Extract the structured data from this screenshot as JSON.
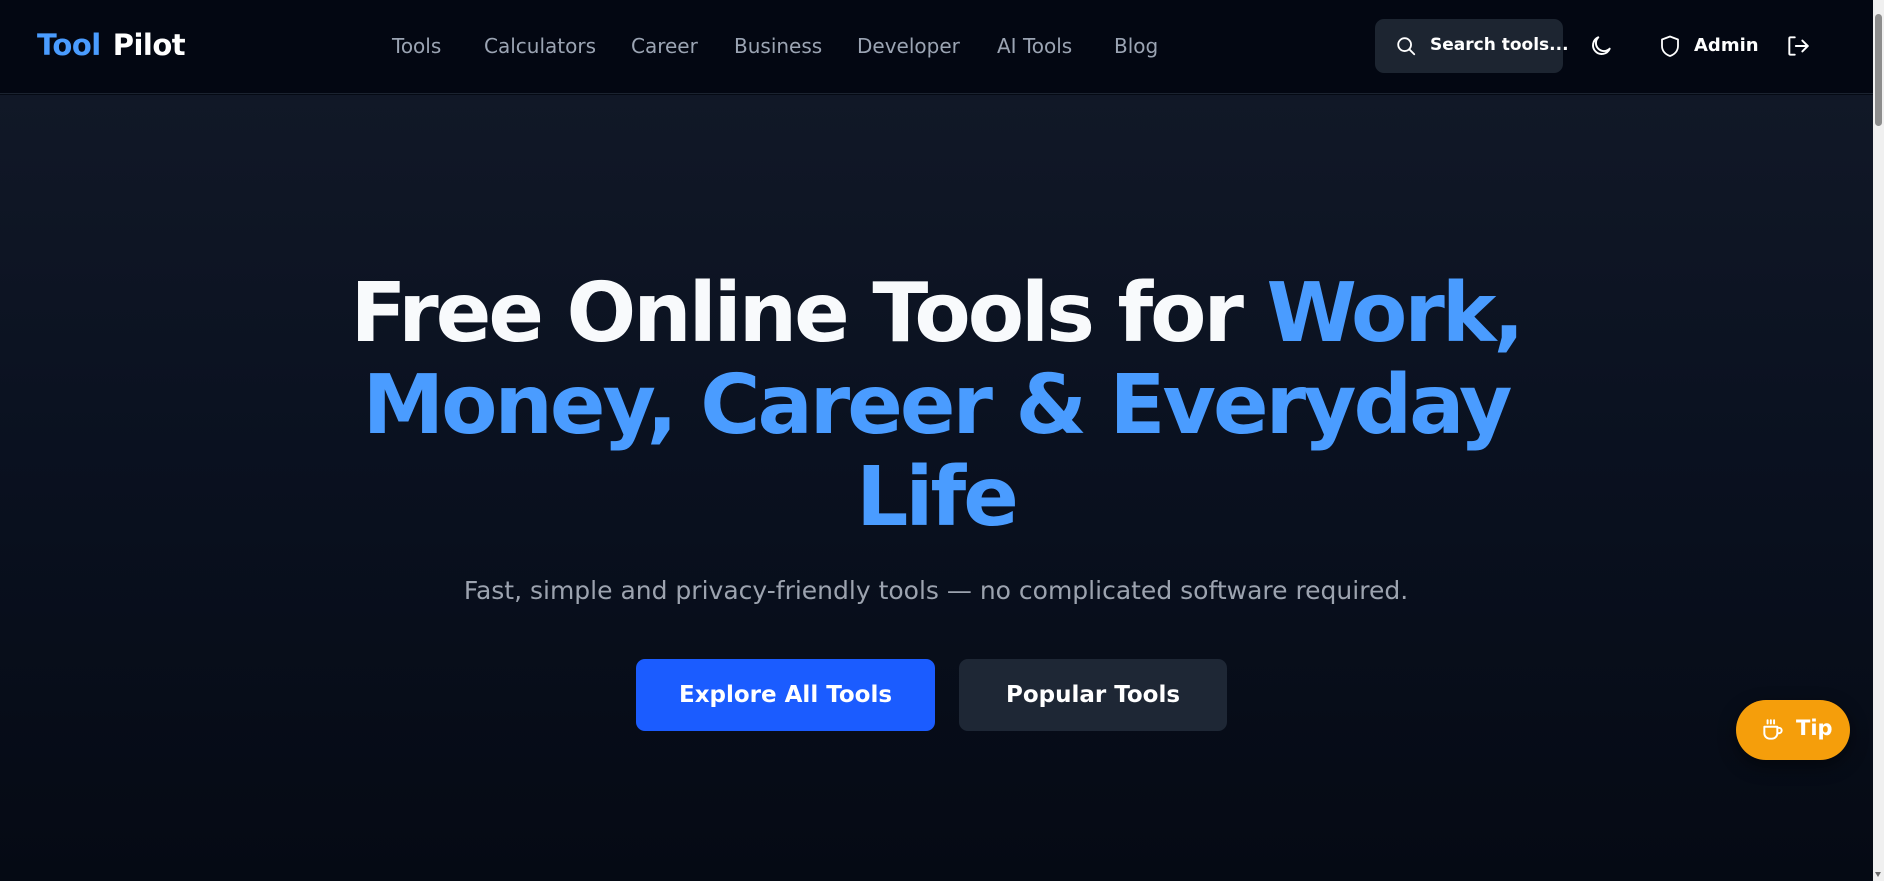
{
  "brand": {
    "part1": "Tool",
    "part2": "Pilot"
  },
  "nav": {
    "items": [
      {
        "label": "Tools"
      },
      {
        "label": "Calculators"
      },
      {
        "label": "Career"
      },
      {
        "label": "Business"
      },
      {
        "label": "Developer"
      },
      {
        "label": "AI Tools"
      },
      {
        "label": "Blog"
      }
    ]
  },
  "header_actions": {
    "search_label": "Search tools...",
    "search_icon": "search-icon",
    "theme_icon": "moon-icon",
    "admin_label": "Admin",
    "admin_icon": "shield-icon",
    "logout_icon": "logout-icon"
  },
  "hero": {
    "title_white": "Free Online Tools for",
    "title_accent": "Work, Money, Career & Everyday Life",
    "subtitle": "Fast, simple and privacy-friendly tools — no complicated software required.",
    "primary_cta": "Explore All Tools",
    "secondary_cta": "Popular Tools"
  },
  "tip_button": {
    "label": "Tip",
    "icon": "coffee-cup-icon"
  },
  "colors": {
    "accent": "#4a9cff",
    "primary_button": "#1b5cff",
    "secondary_button": "#1e2735",
    "tip_button": "#f59e0b",
    "header_bg": "#030712"
  }
}
